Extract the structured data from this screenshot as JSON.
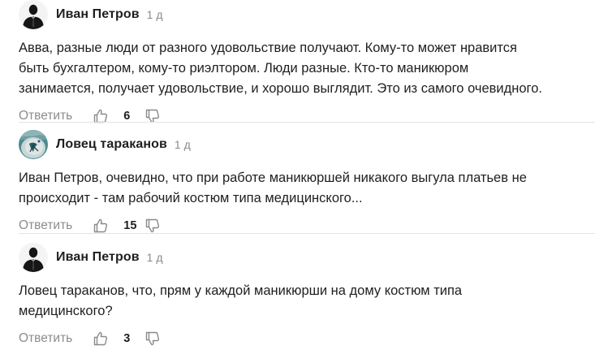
{
  "comments": [
    {
      "author": "Иван Петров",
      "time": "1 д",
      "avatar_icon": "businessman-silhouette-icon",
      "text_lines": [
        "Авва, разные люди от разного удовольствие получают. Кому-то может нравится",
        "быть бухгалтером, кому-то риэлтором. Люди разные. Кто-то маникюром",
        "занимается, получает удовольствие, и хорошо выглядит. Это из самого очевидного."
      ],
      "reply_label": "Ответить",
      "like_count": "6"
    },
    {
      "author": "Ловец тараканов",
      "time": "1 д",
      "avatar_icon": "tattoo-photo-avatar-icon",
      "text_lines": [
        "Иван Петров, очевидно, что при работе маникюршей никакого выгула платьев не",
        "происходит - там рабочий костюм типа медицинского..."
      ],
      "reply_label": "Ответить",
      "like_count": "15"
    },
    {
      "author": "Иван Петров",
      "time": "1 д",
      "avatar_icon": "businessman-silhouette-icon",
      "text_lines": [
        "Ловец тараканов, что, прям у каждой маникюрши на дому костюм типа",
        "медицинского?"
      ],
      "reply_label": "Ответить",
      "like_count": "3"
    }
  ],
  "colors": {
    "text": "#1f1f1f",
    "muted": "#8c8c8c",
    "divider": "#e3e3e3",
    "icon": "#8a8a8a"
  }
}
